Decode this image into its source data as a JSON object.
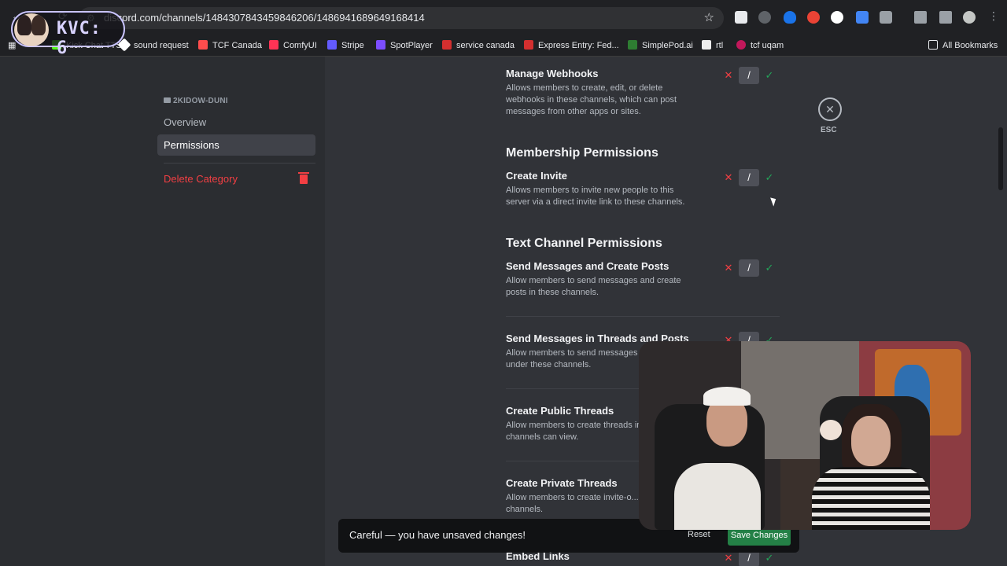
{
  "browser": {
    "url": "discord.com/channels/1484307843459846206/1486941689649168414",
    "bookmarks": [
      {
        "label": "Kick Chat TTS",
        "color": "#53fc18"
      },
      {
        "label": "sound request",
        "color": "#ffffff"
      },
      {
        "label": "TCF Canada",
        "color": "#ff4d4d"
      },
      {
        "label": "ComfyUI",
        "color": "#ff3355"
      },
      {
        "label": "Stripe",
        "color": "#635bff"
      },
      {
        "label": "SpotPlayer",
        "color": "#7c4dff"
      },
      {
        "label": "service canada",
        "color": "#d32f2f"
      },
      {
        "label": "Express Entry: Fed...",
        "color": "#d32f2f"
      },
      {
        "label": "SimplePod.ai",
        "color": "#2e7d32"
      },
      {
        "label": "rtl",
        "color": "#eeeeee"
      },
      {
        "label": "tcf uqam",
        "color": "#c2185b"
      }
    ],
    "all_bookmarks": "All Bookmarks"
  },
  "overlay": {
    "kvc_text": "KVC: 6"
  },
  "sidebar": {
    "category_name": "2KIDOW-DUNI",
    "items": [
      {
        "label": "Overview"
      },
      {
        "label": "Permissions"
      }
    ],
    "delete_label": "Delete Category"
  },
  "close": {
    "label": "ESC"
  },
  "permissions": {
    "manage_webhooks": {
      "title": "Manage Webhooks",
      "desc": "Allows members to create, edit, or delete webhooks in these channels, which can post messages from other apps or sites."
    },
    "membership_header": "Membership Permissions",
    "create_invite": {
      "title": "Create Invite",
      "desc": "Allows members to invite new people to this server via a direct invite link to these channels."
    },
    "text_header": "Text Channel Permissions",
    "send_messages": {
      "title": "Send Messages and Create Posts",
      "desc": "Allow members to send messages and create posts in these channels."
    },
    "send_threads": {
      "title": "Send Messages in Threads and Posts",
      "desc": "Allow members to send messages i... posts under these channels."
    },
    "public_threads": {
      "title": "Create Public Threads",
      "desc": "Allow members to create threads in these channels can view."
    },
    "private_threads": {
      "title": "Create Private Threads",
      "desc": "Allow members to create invite-o... these channels."
    },
    "embed_links": {
      "title": "Embed Links"
    }
  },
  "unsaved": {
    "text": "Careful — you have unsaved changes!",
    "reset": "Reset",
    "save": "Save Changes"
  },
  "icons": {
    "deny": "✕",
    "neutral": "/",
    "allow": "✓",
    "close": "✕"
  }
}
